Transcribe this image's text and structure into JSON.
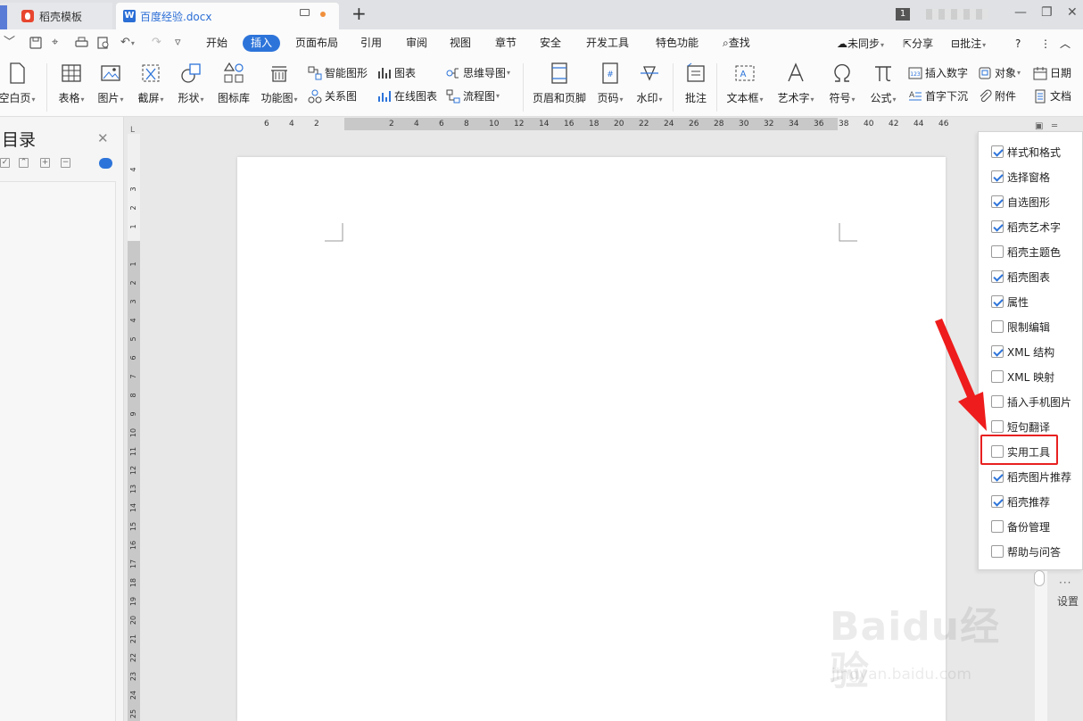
{
  "tabs": [
    {
      "label": "稻壳模板",
      "active": false
    },
    {
      "label": "百度经验.docx",
      "active": true
    }
  ],
  "window": {
    "badge": "1"
  },
  "menubar": {
    "items": [
      "开始",
      "插入",
      "页面布局",
      "引用",
      "审阅",
      "视图",
      "章节",
      "安全",
      "开发工具",
      "特色功能"
    ],
    "active": "插入",
    "search": "查找",
    "sync": "未同步",
    "share": "分享",
    "comment": "批注"
  },
  "ribbon": {
    "blank_page": "空白页",
    "table": "表格",
    "picture": "图片",
    "screenshot": "截屏",
    "shape": "形状",
    "icon_lib": "图标库",
    "func_chart": "功能图",
    "smart_shape": "智能图形",
    "relation_chart": "关系图",
    "chart": "图表",
    "online_chart": "在线图表",
    "mindmap": "思维导图",
    "flowchart": "流程图",
    "header_footer": "页眉和页脚",
    "page_num": "页码",
    "watermark": "水印",
    "comment": "批注",
    "textbox": "文本框",
    "wordart": "艺术字",
    "symbol": "符号",
    "formula": "公式",
    "insert_number": "插入数字",
    "dropcap": "首字下沉",
    "object": "对象",
    "attachment": "附件",
    "date": "日期",
    "document": "文档"
  },
  "nav": {
    "title": "目录"
  },
  "ruler": {
    "horizontal": [
      "6",
      "4",
      "2",
      "2",
      "4",
      "6",
      "8",
      "10",
      "12",
      "14",
      "16",
      "18",
      "20",
      "22",
      "24",
      "26",
      "28",
      "30",
      "32",
      "34",
      "36",
      "38",
      "40",
      "42",
      "44",
      "46"
    ],
    "vertical": [
      "4",
      "3",
      "2",
      "1",
      "1",
      "2",
      "3",
      "4",
      "5",
      "6",
      "7",
      "8",
      "9",
      "10",
      "11",
      "12",
      "13",
      "14",
      "15",
      "16",
      "17",
      "18",
      "19",
      "20",
      "21",
      "22",
      "23",
      "24",
      "25"
    ],
    "corner": "L"
  },
  "settings_panel": {
    "items": [
      {
        "label": "样式和格式",
        "checked": true
      },
      {
        "label": "选择窗格",
        "checked": true
      },
      {
        "label": "自选图形",
        "checked": true
      },
      {
        "label": "稻壳艺术字",
        "checked": true
      },
      {
        "label": "稻壳主题色",
        "checked": false
      },
      {
        "label": "稻壳图表",
        "checked": true
      },
      {
        "label": "属性",
        "checked": true
      },
      {
        "label": "限制编辑",
        "checked": false
      },
      {
        "label": "XML 结构",
        "checked": true
      },
      {
        "label": "XML 映射",
        "checked": false
      },
      {
        "label": "插入手机图片",
        "checked": false
      },
      {
        "label": "短句翻译",
        "checked": false
      },
      {
        "label": "实用工具",
        "checked": false
      },
      {
        "label": "稻壳图片推荐",
        "checked": true
      },
      {
        "label": "稻壳推荐",
        "checked": true
      },
      {
        "label": "备份管理",
        "checked": false
      },
      {
        "label": "帮助与问答",
        "checked": false
      }
    ],
    "highlighted": "实用工具",
    "settings_label": "设置",
    "dots": "···"
  },
  "watermark": {
    "brand": "Baidu经验",
    "sub": "jingyan.baidu.com"
  },
  "colors": {
    "accent": "#2d74da",
    "highlight": "#e82020",
    "tab_brand": "#e8452f"
  }
}
